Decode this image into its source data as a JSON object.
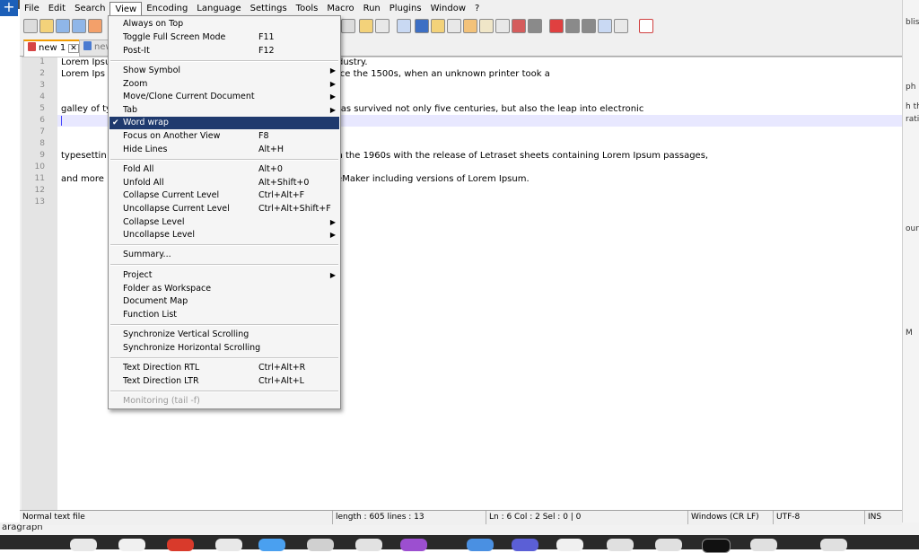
{
  "background": {
    "right_edge_fragments": [
      "blis",
      "ph",
      "h th",
      "rati",
      "oun",
      "M"
    ],
    "bottom_fragment": "aragraph"
  },
  "menubar": [
    "File",
    "Edit",
    "Search",
    "View",
    "Encoding",
    "Language",
    "Settings",
    "Tools",
    "Macro",
    "Run",
    "Plugins",
    "Window",
    "?"
  ],
  "close_label": "X",
  "tabs": [
    {
      "label": "new 1",
      "active": true
    },
    {
      "label": "new",
      "active": false
    }
  ],
  "editor": {
    "line_numbers": [
      "1",
      "2",
      "3",
      "4",
      "5",
      "6",
      "7",
      "8",
      "9",
      "10",
      "11",
      "12",
      "13"
    ],
    "lines": [
      {
        "n": "1",
        "left": "Lorem Ipsu",
        "right": "ng industry."
      },
      {
        "n": "2",
        "left": " Lorem Ips",
        "right": "er since the 1500s, when an unknown printer took a"
      },
      {
        "n": "3",
        "left": "",
        "right": ""
      },
      {
        "n": "4",
        "left": "galley of ty",
        "right": ". It has survived not only five centuries, but also the leap into electronic"
      },
      {
        "n": "5",
        "left": "",
        "right": ""
      },
      {
        "n": "6",
        "left": "",
        "right": ""
      },
      {
        "n": "7",
        "left": "",
        "right": ""
      },
      {
        "n": "8",
        "left": "",
        "right": ""
      },
      {
        "n": "9",
        "left": "typesettin",
        "right": "ed in the 1960s with the release of Letraset sheets containing Lorem Ipsum passages,"
      },
      {
        "n": "10",
        "left": "",
        "right": ""
      },
      {
        "n": "11",
        "left": "and more",
        "right": "PageMaker including versions of Lorem Ipsum."
      },
      {
        "n": "12",
        "left": "",
        "right": ""
      },
      {
        "n": "13",
        "left": "",
        "right": ""
      }
    ]
  },
  "view_menu": [
    {
      "label": "Always on Top",
      "shortcut": "",
      "submenu": false
    },
    {
      "label": "Toggle Full Screen Mode",
      "shortcut": "F11",
      "submenu": false
    },
    {
      "label": "Post-It",
      "shortcut": "F12",
      "submenu": false
    },
    {
      "sep": true
    },
    {
      "label": "Show Symbol",
      "shortcut": "",
      "submenu": true
    },
    {
      "label": "Zoom",
      "shortcut": "",
      "submenu": true
    },
    {
      "label": "Move/Clone Current Document",
      "shortcut": "",
      "submenu": true
    },
    {
      "label": "Tab",
      "shortcut": "",
      "submenu": true
    },
    {
      "label": "Word wrap",
      "shortcut": "",
      "submenu": false,
      "checked": true,
      "highlighted": true
    },
    {
      "label": "Focus on Another View",
      "shortcut": "F8",
      "submenu": false
    },
    {
      "label": "Hide Lines",
      "shortcut": "Alt+H",
      "submenu": false
    },
    {
      "sep": true
    },
    {
      "label": "Fold All",
      "shortcut": "Alt+0",
      "submenu": false
    },
    {
      "label": "Unfold All",
      "shortcut": "Alt+Shift+0",
      "submenu": false
    },
    {
      "label": "Collapse Current Level",
      "shortcut": "Ctrl+Alt+F",
      "submenu": false
    },
    {
      "label": "Uncollapse Current Level",
      "shortcut": "Ctrl+Alt+Shift+F",
      "submenu": false
    },
    {
      "label": "Collapse Level",
      "shortcut": "",
      "submenu": true
    },
    {
      "label": "Uncollapse Level",
      "shortcut": "",
      "submenu": true
    },
    {
      "sep": true
    },
    {
      "label": "Summary...",
      "shortcut": "",
      "submenu": false
    },
    {
      "sep": true
    },
    {
      "label": "Project",
      "shortcut": "",
      "submenu": true
    },
    {
      "label": "Folder as Workspace",
      "shortcut": "",
      "submenu": false
    },
    {
      "label": "Document Map",
      "shortcut": "",
      "submenu": false
    },
    {
      "label": "Function List",
      "shortcut": "",
      "submenu": false
    },
    {
      "sep": true
    },
    {
      "label": "Synchronize Vertical Scrolling",
      "shortcut": "",
      "submenu": false
    },
    {
      "label": "Synchronize Horizontal Scrolling",
      "shortcut": "",
      "submenu": false
    },
    {
      "sep": true
    },
    {
      "label": "Text Direction RTL",
      "shortcut": "Ctrl+Alt+R",
      "submenu": false
    },
    {
      "label": "Text Direction LTR",
      "shortcut": "Ctrl+Alt+L",
      "submenu": false
    },
    {
      "sep": true
    },
    {
      "label": "Monitoring (tail -f)",
      "shortcut": "",
      "submenu": false,
      "disabled": true
    }
  ],
  "statusbar": {
    "type": "Normal text file",
    "length": "length : 605    lines : 13",
    "position": "Ln : 6    Col : 2    Sel : 0 | 0",
    "eol": "Windows (CR LF)",
    "encoding": "UTF-8",
    "mode": "INS"
  },
  "colors": {
    "menu_highlight": "#1f3a6e",
    "active_tab_accent": "#f29b00",
    "caret_line": "#e8e8ff"
  }
}
